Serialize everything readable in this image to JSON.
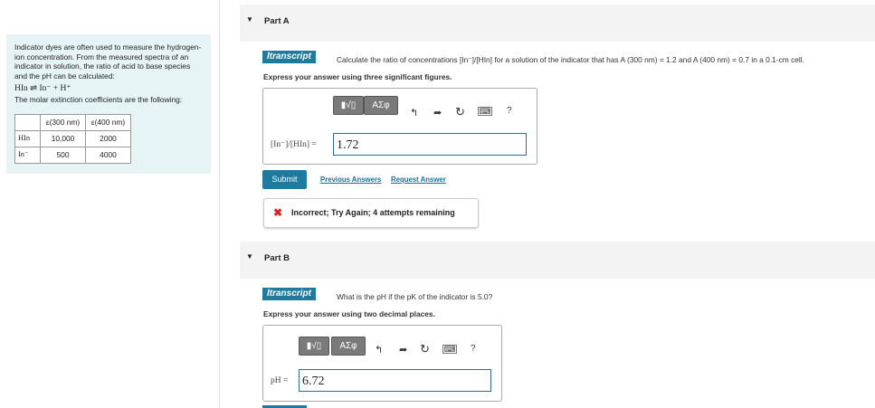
{
  "problem": {
    "intro": "Indicator dyes are often used to measure the hydrogen-ion concentration. From the measured spectra of an indicator in solution, the ratio of acid to base species and the pH can be calculated:",
    "equation": "HIn ⇌ In⁻ + H⁺",
    "coef_intro": "The molar extinction coefficients are the following:",
    "table": {
      "headers": [
        "",
        "ε(300 nm)",
        "ε(400 nm)"
      ],
      "rows": [
        [
          "HIn",
          "10,000",
          "2000"
        ],
        [
          "In⁻",
          "500",
          "4000"
        ]
      ]
    }
  },
  "partA": {
    "label": "Part A",
    "badge": "ltranscript",
    "question": "Calculate the ratio of concentrations [In⁻]/[HIn] for a solution of the indicator that has A (300 nm) = 1.2 and A (400 nm) = 0.7 in a 0.1-cm cell.",
    "instruction": "Express your answer using three significant figures.",
    "answer_label": "[In⁻]/[HIn] =",
    "answer_value": "1.72",
    "submit": "Submit",
    "prev_answers": "Previous Answers",
    "request_answer": "Request Answer",
    "feedback": "Incorrect; Try Again; 4 attempts remaining"
  },
  "partB": {
    "label": "Part B",
    "badge": "ltranscript",
    "question": "What is the pH if the pK of the indicator is 5.0?",
    "instruction": "Express your answer using two decimal places.",
    "answer_label": "pH =",
    "answer_value": "6.72"
  },
  "toolbar": {
    "templates": "▮√▯",
    "greek": "ΑΣφ",
    "help": "?"
  }
}
